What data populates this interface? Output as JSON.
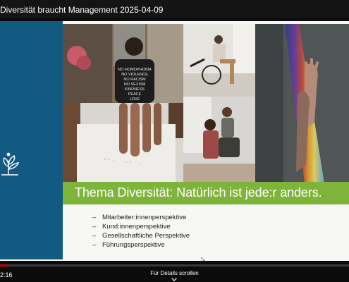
{
  "window": {
    "title": "Diversität braucht Management 2025-04-09"
  },
  "slide": {
    "banner_title": "Thema Diversität:  Natürlich ist jede:r anders.",
    "bullets": [
      "Mitarbeiter:innenperspektive",
      "Kund:innenperspektive",
      "Gesellschaftliche Perspektive",
      "Führungsperspektive"
    ],
    "photo_shirt_text": [
      "NO HOMOPHOBIA",
      "NO VIOLENCE",
      "NO RACISM",
      "NO SEXISM",
      "KINDNESS",
      "PEACE",
      "LOVE"
    ],
    "colors": {
      "sidebar": "#125a82",
      "banner": "#7fb43a",
      "background": "#f7f7f5"
    }
  },
  "player": {
    "time": "2:16",
    "scroll_hint": "Für Details scrollen",
    "progress_fraction": 0.02,
    "progress_color": "#cc0000"
  },
  "icons": [
    "plant-icon",
    "chevron-down-icon",
    "mouse-cursor-icon"
  ]
}
